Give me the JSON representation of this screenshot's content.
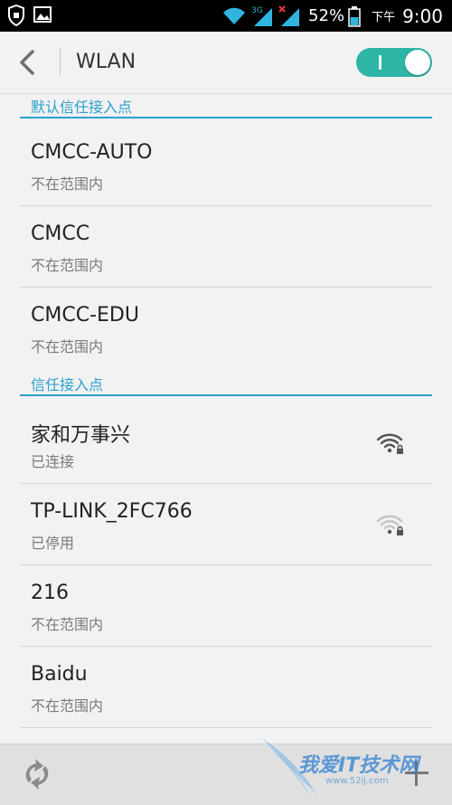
{
  "status_bar": {
    "battery_percent": "52%",
    "time_prefix": "下午",
    "time": "9:00",
    "network_type": "3G",
    "icons": [
      "shield-icon",
      "image-icon",
      "wifi-signal-icon",
      "cell-signal-icon",
      "cell-signal-noservice-icon",
      "battery-icon"
    ]
  },
  "header": {
    "title": "WLAN",
    "wlan_enabled": true
  },
  "sections": [
    {
      "label": "默认信任接入点",
      "networks": [
        {
          "name": "CMCC-AUTO",
          "status": "不在范围内"
        },
        {
          "name": "CMCC",
          "status": "不在范围内"
        },
        {
          "name": "CMCC-EDU",
          "status": "不在范围内"
        }
      ]
    },
    {
      "label": "信任接入点",
      "networks": [
        {
          "name": "家和万事兴",
          "status": "已连接",
          "signal_icon": "wifi-lock-icon"
        },
        {
          "name": "TP-LINK_2FC766",
          "status": "已停用",
          "signal_icon": "wifi-lock-weak-icon"
        },
        {
          "name": "216",
          "status": "不在范围内"
        },
        {
          "name": "Baidu",
          "status": "不在范围内"
        }
      ]
    }
  ],
  "bottom_bar": {
    "icons": [
      "refresh-icon",
      "add-icon"
    ]
  },
  "watermark": {
    "text": "我爱IT技术网",
    "url": "www.52ij.com"
  },
  "colors": {
    "accent": "#2aa0cf",
    "toggle_on": "#2db5a6",
    "background": "#f2f2f2",
    "statusbar": "#000000"
  }
}
